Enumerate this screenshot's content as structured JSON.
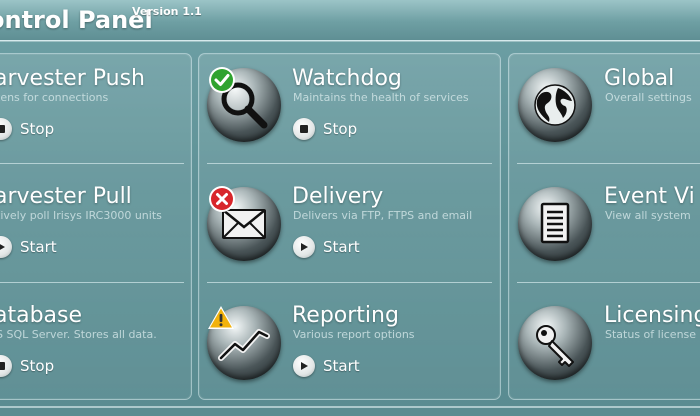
{
  "app": {
    "title": "ontrol Panel",
    "version": "Version 1.1"
  },
  "tiles": {
    "harvester_push": {
      "title": "arvester Push",
      "desc": "tens for connections",
      "action": "Stop",
      "action_icon": "stop-icon",
      "icon": "harvester-push-icon"
    },
    "harvester_pull": {
      "title": "arvester Pull",
      "desc": "tively poll Irisys IRC3000 units",
      "action": "Start",
      "action_icon": "play-icon",
      "icon": "harvester-pull-icon"
    },
    "database": {
      "title": "atabase",
      "desc": "S SQL Server. Stores all data.",
      "action": "Stop",
      "action_icon": "stop-icon",
      "icon": "database-icon"
    },
    "watchdog": {
      "title": "Watchdog",
      "desc": "Maintains the health of services",
      "action": "Stop",
      "action_icon": "stop-icon",
      "icon": "magnifier-icon",
      "badge": "check-badge-icon"
    },
    "delivery": {
      "title": "Delivery",
      "desc": "Delivers via FTP, FTPS and email",
      "action": "Start",
      "action_icon": "play-icon",
      "icon": "envelope-icon",
      "badge": "error-badge-icon"
    },
    "reporting": {
      "title": "Reporting",
      "desc": "Various report options",
      "action": "Start",
      "action_icon": "play-icon",
      "icon": "chart-line-icon",
      "badge": "warning-badge-icon"
    },
    "global": {
      "title": "Global",
      "desc": "Overall settings",
      "icon": "globe-icon"
    },
    "event_viewer": {
      "title": "Event Vi",
      "desc": "View all system",
      "icon": "document-icon"
    },
    "licensing": {
      "title": "Licensing",
      "desc": "Status of license",
      "icon": "key-icon"
    }
  },
  "colors": {
    "background": "#5f9297",
    "badge_success": "#2fa32f",
    "badge_error": "#d8262b",
    "badge_warning": "#f2b20a"
  }
}
